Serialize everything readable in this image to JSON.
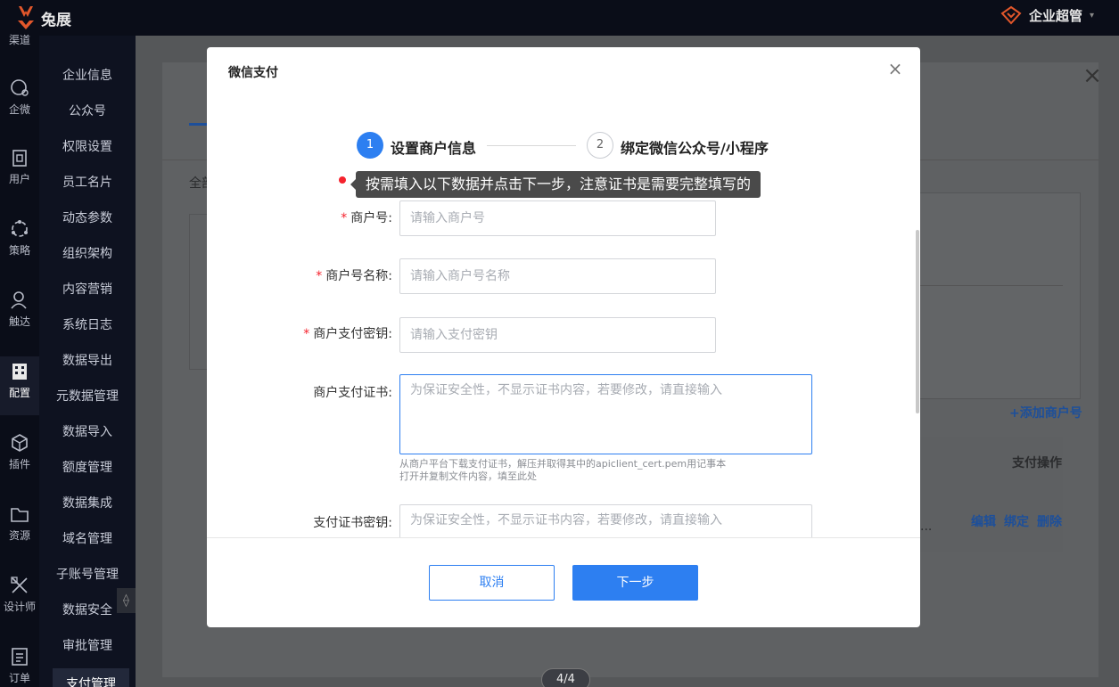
{
  "app": {
    "logo_text": "兔展",
    "user_label": "企业超管",
    "user_caret": "▾"
  },
  "rail": {
    "items": [
      {
        "label": "渠道",
        "icon": "channel-icon"
      },
      {
        "label": "企微",
        "icon": "chat-icon"
      },
      {
        "label": "用户",
        "icon": "user-doc-icon"
      },
      {
        "label": "策略",
        "icon": "strategy-icon"
      },
      {
        "label": "触达",
        "icon": "reach-icon"
      },
      {
        "label": "配置",
        "icon": "config-icon"
      },
      {
        "label": "插件",
        "icon": "plugin-icon"
      },
      {
        "label": "资源",
        "icon": "folder-icon"
      },
      {
        "label": "设计师",
        "icon": "design-icon"
      },
      {
        "label": "订单",
        "icon": "order-icon"
      }
    ]
  },
  "submenu": {
    "items": [
      "企业信息",
      "公众号",
      "权限设置",
      "员工名片",
      "动态参数",
      "组织架构",
      "内容营销",
      "系统日志",
      "数据导出",
      "元数据管理",
      "数据导入",
      "额度管理",
      "数据集成",
      "域名管理",
      "子账号管理",
      "数据安全",
      "审批管理",
      "支付管理"
    ]
  },
  "background": {
    "tab_partial": "全部",
    "add_merchant": "+添加商户号",
    "col_pay_ops": "支付操作",
    "row_ellipsis": "...",
    "edit": "编辑",
    "bind": "绑定",
    "delete": "删除",
    "close_icon": "×"
  },
  "modal": {
    "title": "微信支付",
    "close": "×",
    "steps": [
      {
        "num": "1",
        "label": "设置商户信息"
      },
      {
        "num": "2",
        "label": "绑定微信公众号/小程序"
      }
    ],
    "tooltip": "按需填入以下数据并点击下一步，注意证书是需要完整填写的",
    "fields": {
      "merchant_id": {
        "label": "商户号:",
        "placeholder": "请输入商户号",
        "required": "*"
      },
      "merchant_name": {
        "label": "商户号名称:",
        "placeholder": "请输入商户号名称",
        "required": "*"
      },
      "pay_key": {
        "label": "商户支付密钥:",
        "placeholder": "请输入支付密钥",
        "required": "*"
      },
      "pay_cert": {
        "label": "商户支付证书:",
        "placeholder": "为保证安全性，不显示证书内容，若要修改，请直接输入"
      },
      "cert_hint_1": "从商户平台下载支付证书，解压并取得其中的apiclient_cert.pem用记事本",
      "cert_hint_2": "打开并复制文件内容，填至此处",
      "cert_key": {
        "label": "支付证书密钥:",
        "placeholder": "为保证安全性，不显示证书内容，若要修改，请直接输入"
      }
    },
    "cancel": "取消",
    "next": "下一步"
  },
  "pager": "4/4",
  "handle_icon": "⟠"
}
